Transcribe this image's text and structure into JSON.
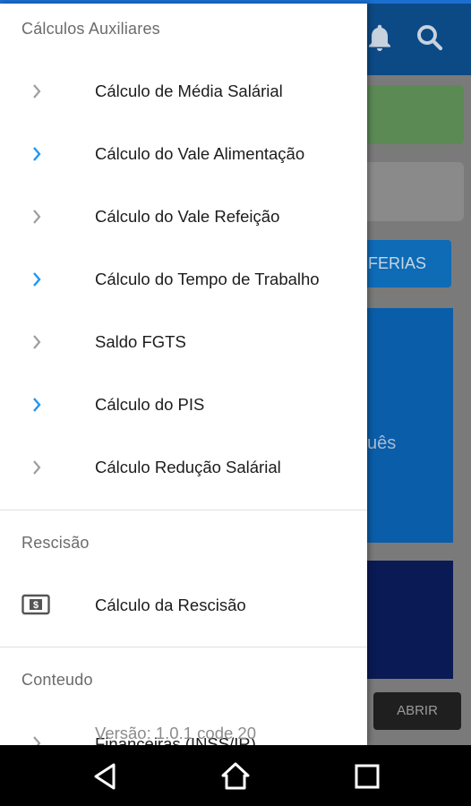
{
  "background": {
    "ferias_label": "FERIAS",
    "card_text": "uês",
    "abrir_label": "ABRIR"
  },
  "drawer": {
    "sections": [
      {
        "title": "Cálculos Auxiliares",
        "items": [
          {
            "label": "Cálculo de Média Salárial",
            "chevron_color": "#9e9e9e"
          },
          {
            "label": "Cálculo do Vale Alimentação",
            "chevron_color": "#2196f3"
          },
          {
            "label": "Cálculo do Vale Refeição",
            "chevron_color": "#9e9e9e"
          },
          {
            "label": "Cálculo do Tempo de Trabalho",
            "chevron_color": "#2196f3"
          },
          {
            "label": "Saldo FGTS",
            "chevron_color": "#9e9e9e"
          },
          {
            "label": "Cálculo do PIS",
            "chevron_color": "#2196f3"
          },
          {
            "label": "Cálculo Redução Salárial",
            "chevron_color": "#9e9e9e"
          }
        ]
      },
      {
        "title": "Rescisão",
        "items": [
          {
            "label": "Cálculo da Rescisão",
            "icon": "money-icon"
          }
        ]
      },
      {
        "title": "Conteudo",
        "items": [
          {
            "label": "Financeiras (INSS/IR)",
            "chevron_color": "#9e9e9e"
          }
        ]
      }
    ],
    "version_text": "Versão: 1.0.1 code 20"
  },
  "colors": {
    "accent": "#2196f3",
    "topbar": "#0c4a86"
  }
}
